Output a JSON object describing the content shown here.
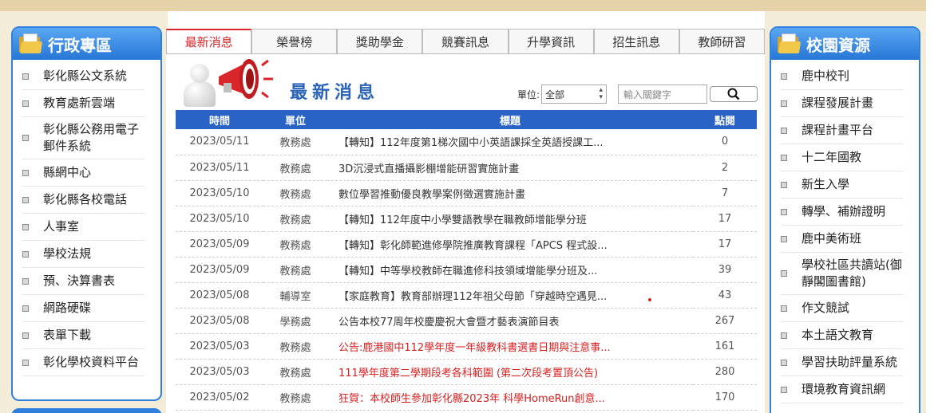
{
  "left_panel": {
    "title": "行政專區",
    "items": [
      "彰化縣公文系統",
      "教育處新雲端",
      "彰化縣公務用電子郵件系統",
      "縣網中心",
      "彰化縣各校電話",
      "人事室",
      "學校法規",
      "預、決算書表",
      "網路硬碟",
      "表單下載",
      "彰化學校資料平台"
    ]
  },
  "right_panel": {
    "title": "校園資源",
    "items": [
      "鹿中校刊",
      "課程發展計畫",
      "課程計畫平台",
      "十二年國教",
      "新生入學",
      "轉學、補辦證明",
      "鹿中美術班",
      "學校社區共讀站(御靜閣圖書館)",
      "作文競試",
      "本土語文教育",
      "學習扶助評量系統",
      "環境教育資訊網"
    ]
  },
  "tabs": [
    "最新消息",
    "榮譽榜",
    "獎助學金",
    "競賽訊息",
    "升學資訊",
    "招生訊息",
    "教師研習"
  ],
  "news": {
    "title": "最新消息",
    "unit_label": "單位:",
    "unit_selected": "全部",
    "keyword_placeholder": "輸入關鍵字",
    "columns": [
      "時間",
      "單位",
      "標題",
      "點閱"
    ],
    "rows": [
      {
        "date": "2023/05/11",
        "unit": "教務處",
        "title": "【轉知】112年度第1梯次國中小英語課採全英語授課工...",
        "hits": "0",
        "red": false
      },
      {
        "date": "2023/05/11",
        "unit": "教務處",
        "title": "3D沉浸式直播攝影棚增能研習實施計畫",
        "hits": "2",
        "red": false
      },
      {
        "date": "2023/05/10",
        "unit": "教務處",
        "title": "數位學習推動優良教學案例徵選實施計畫",
        "hits": "7",
        "red": false
      },
      {
        "date": "2023/05/10",
        "unit": "教務處",
        "title": "【轉知】112年度中小學雙語教學在職教師增能學分班",
        "hits": "17",
        "red": false
      },
      {
        "date": "2023/05/09",
        "unit": "教務處",
        "title": "【轉知】彰化師範進修學院推廣教育課程「APCS 程式設...",
        "hits": "17",
        "red": false
      },
      {
        "date": "2023/05/09",
        "unit": "教務處",
        "title": "【轉知】中等學校教師在職進修科技領域增能學分班及...",
        "hits": "39",
        "red": false
      },
      {
        "date": "2023/05/08",
        "unit": "輔導室",
        "title": "【家庭教育】教育部辦理112年祖父母節「穿越時空遇見...",
        "hits": "43",
        "red": false
      },
      {
        "date": "2023/05/08",
        "unit": "學務處",
        "title": "公告本校77周年校慶慶祝大會暨才藝表演節目表",
        "hits": "267",
        "red": false
      },
      {
        "date": "2023/05/03",
        "unit": "教務處",
        "title": "公告:鹿港國中112學年度一年級教科書選書日期與注意事...",
        "hits": "161",
        "red": true
      },
      {
        "date": "2023/05/03",
        "unit": "教務處",
        "title": "111學年度第二學期段考各科範圍 (第二次段考置頂公告)",
        "hits": "280",
        "red": true
      },
      {
        "date": "2023/05/02",
        "unit": "教務處",
        "title": "狂賀：本校師生參加彰化縣2023年 科學HomeRun創意...",
        "hits": "170",
        "red": true
      }
    ]
  }
}
